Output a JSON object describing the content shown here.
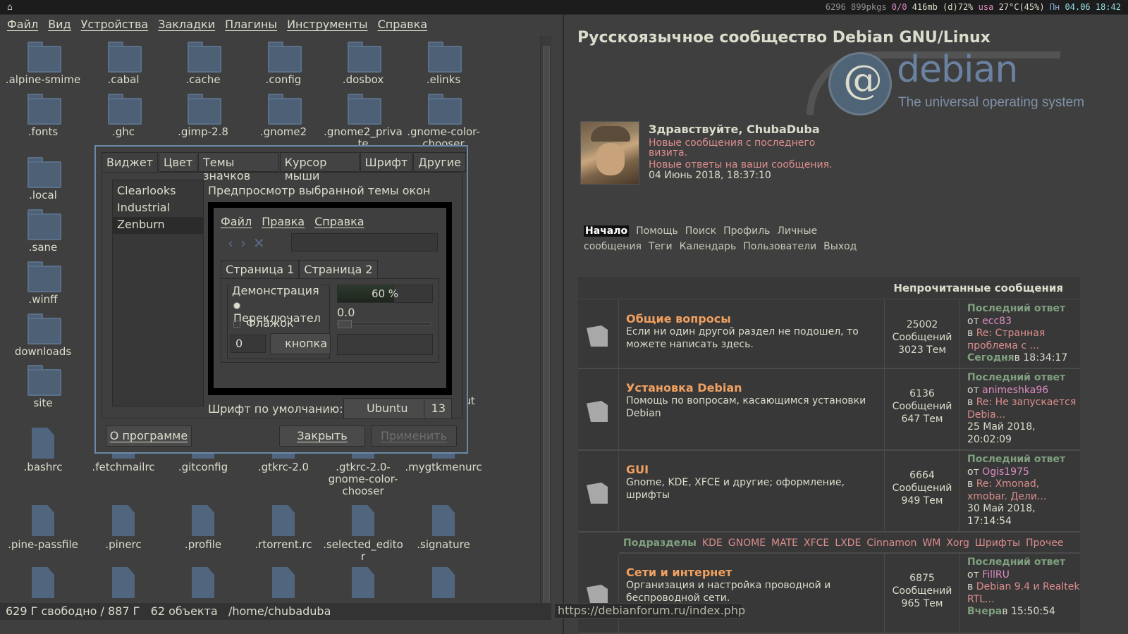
{
  "topbar": {
    "home_glyph": "⌂",
    "s1": "6296 899pkgs",
    "s2": "0/0",
    "s3": "416mb (d)72%",
    "s4": "usa",
    "s5": "27°C(45%)",
    "s6": "Пн",
    "s7": "04.06 18:42"
  },
  "fm": {
    "menu": [
      "Файл",
      "Вид",
      "Устройства",
      "Закладки",
      "Плагины",
      "Инструменты",
      "Справка"
    ],
    "folders": [
      ".alpine-smime",
      ".cabal",
      ".cache",
      ".config",
      ".dosbox",
      ".elinks",
      ".fonts",
      ".ghc",
      ".gimp-2.8",
      ".gnome2",
      ".gnome2_priva\nte",
      ".gnome-color-\nchooser",
      ".local",
      ".sane",
      ".winff",
      "downloads",
      "site"
    ],
    "files": [
      ".bashrc",
      ".fetchmailrc",
      ".gitconfig",
      ".gtkrc-2.0",
      ".gtkrc-2.0-\ngnome-color-\nchooser",
      ".mygtkmenurc",
      ".pine-passfile",
      ".pinerc",
      ".profile",
      ".rtorrent.rc",
      ".selected_edito\nr",
      ".signature"
    ],
    "partial_label": "ut",
    "status": "629 Г свободно / 887 Г   62 объекта   /home/chubaduba"
  },
  "dlg": {
    "tabs": [
      "Виджет",
      "Цвет",
      "Темы значков",
      "Курсор мыши",
      "Шрифт",
      "Другие"
    ],
    "themes": [
      "Clearlooks",
      "Industrial",
      "Zenburn"
    ],
    "selected_theme": "Zenburn",
    "preview_title": "Предпросмотр выбранной темы окон",
    "pv_menu": [
      "Файл",
      "Правка",
      "Справка"
    ],
    "pv_tabs": [
      "Страница 1",
      "Страница 2"
    ],
    "pv_frame": "Демонстрация",
    "pv_radio": "Переключател",
    "pv_check": "Флажок",
    "pv_spin": "0",
    "pv_button": "кнопка",
    "pv_progress": 0.6,
    "pv_progress_label": "60 %",
    "pv_scale": "0.0",
    "font_label": "Шрифт по умолчанию:",
    "font_name": "Ubuntu",
    "font_size": "13",
    "btn_about": "О программе",
    "btn_close": "Закрыть",
    "btn_apply": "Применить"
  },
  "forum": {
    "title": "Русскоязычное сообщество Debian GNU/Linux",
    "logo_word": "debian",
    "logo_tag": "The universal operating system",
    "greeting": "Здравствуйте, ChubaDuba",
    "msg_new": "Новые сообщения с последнего визита.",
    "msg_replies": "Новые ответы на ваши сообщения.",
    "last_visit": "04 Июнь 2018, 18:37:10",
    "nav": [
      "Начало",
      "Помощь",
      "Поиск",
      "Профиль",
      "Личные сообщения",
      "Теги",
      "Календарь",
      "Пользователи",
      "Выход"
    ],
    "header": "Непрочитанные сообщения",
    "rows": [
      {
        "title": "Общие вопросы",
        "desc": "Если ни один другой раздел не подошел, то можете написать здесь.",
        "posts": "25002",
        "posts_lbl": "Сообщений",
        "topics": "3023 Тем",
        "last_lbl": "Последний ответ",
        "from": "от",
        "user": "ecc83",
        "in": "в",
        "topic": "Re: Странная проблема с ...",
        "date_a": "Сегодня",
        "date_b": "в 18:34:17"
      },
      {
        "title": "Установка Debian",
        "desc": "Помощь по вопросам, касающимся установки Debian",
        "posts": "6136",
        "posts_lbl": "Сообщений",
        "topics": "647 Тем",
        "last_lbl": "Последний ответ",
        "from": "от",
        "user": "animeshka96",
        "in": "в",
        "topic": "Re: Не запускается Debia...",
        "date_a": "",
        "date_b": "25 Май 2018, 20:02:09"
      },
      {
        "title": "GUI",
        "desc": "Gnome, KDE, XFCE и другие; оформление, шрифты",
        "posts": "6664",
        "posts_lbl": "Сообщений",
        "topics": "949 Тем",
        "last_lbl": "Последний ответ",
        "from": "от",
        "user": "Ogis1975",
        "in": "в",
        "topic": "Re: Xmonad, xmobar. Дели...",
        "date_a": "",
        "date_b": "30 Май 2018, 17:14:54"
      },
      {
        "title": "Сети и интернет",
        "desc": "Организация и настройка проводной и беспроводной сети.",
        "posts": "6875",
        "posts_lbl": "Сообщений",
        "topics": "965 Тем",
        "last_lbl": "Последний ответ",
        "from": "от",
        "user": "FillRU",
        "in": "в",
        "topic": "Debian 9.4 и Realtek RTL...",
        "date_a": "Вчера",
        "date_b": "в 15:50:54"
      }
    ],
    "sub_label": "Подразделы",
    "subs": [
      "KDE",
      "GNOME",
      "MATE",
      "XFCE",
      "LXDE",
      "Cinnamon",
      "WM",
      "Xorg",
      "Шрифты",
      "Прочее"
    ],
    "status_url": "https://debianforum.ru/index.php"
  }
}
